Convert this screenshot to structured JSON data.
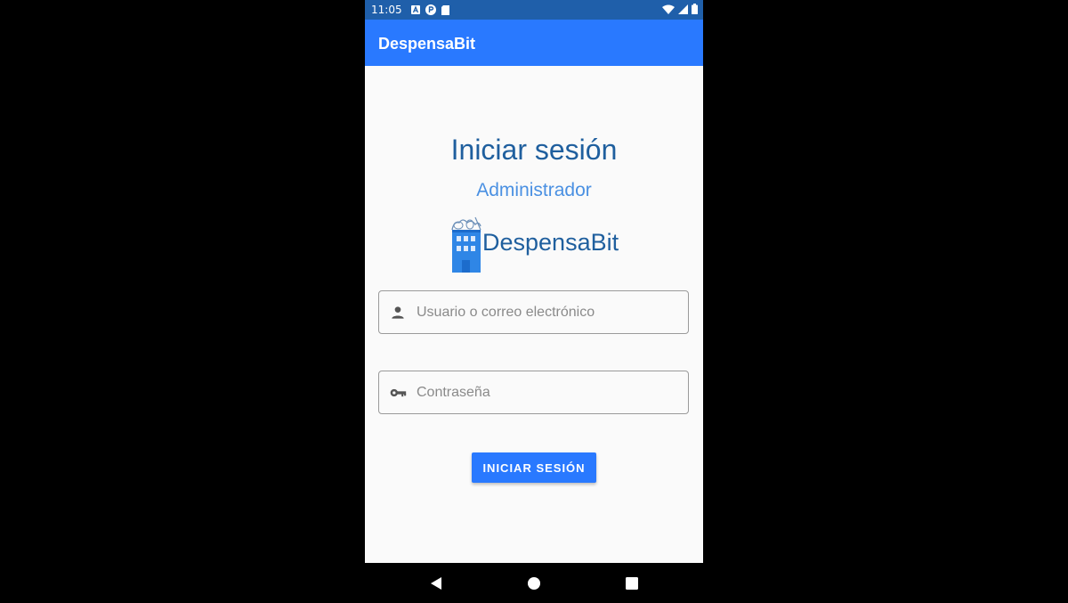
{
  "status_bar": {
    "time": "11:05",
    "icons_left": [
      "notification-a-icon",
      "notification-p-icon",
      "sd-card-icon"
    ],
    "icons_right": [
      "wifi-icon",
      "signal-icon",
      "battery-icon"
    ]
  },
  "app_bar": {
    "title": "DespensaBit"
  },
  "login": {
    "title": "Iniciar sesión",
    "subtitle": "Administrador",
    "logo_text": "DespensaBit",
    "username": {
      "placeholder": "Usuario o correo electrónico",
      "value": "",
      "icon": "person-icon"
    },
    "password": {
      "placeholder": "Contraseña",
      "value": "",
      "icon": "key-icon"
    },
    "submit_label": "INICIAR SESIÓN"
  },
  "nav_bar": {
    "buttons": [
      "back-icon",
      "home-icon",
      "recents-icon"
    ]
  },
  "colors": {
    "status_bar": "#1f5faa",
    "app_bar": "#2979ff",
    "title": "#1f5f9e",
    "subtitle": "#4a90e2",
    "background": "#fafafa"
  }
}
